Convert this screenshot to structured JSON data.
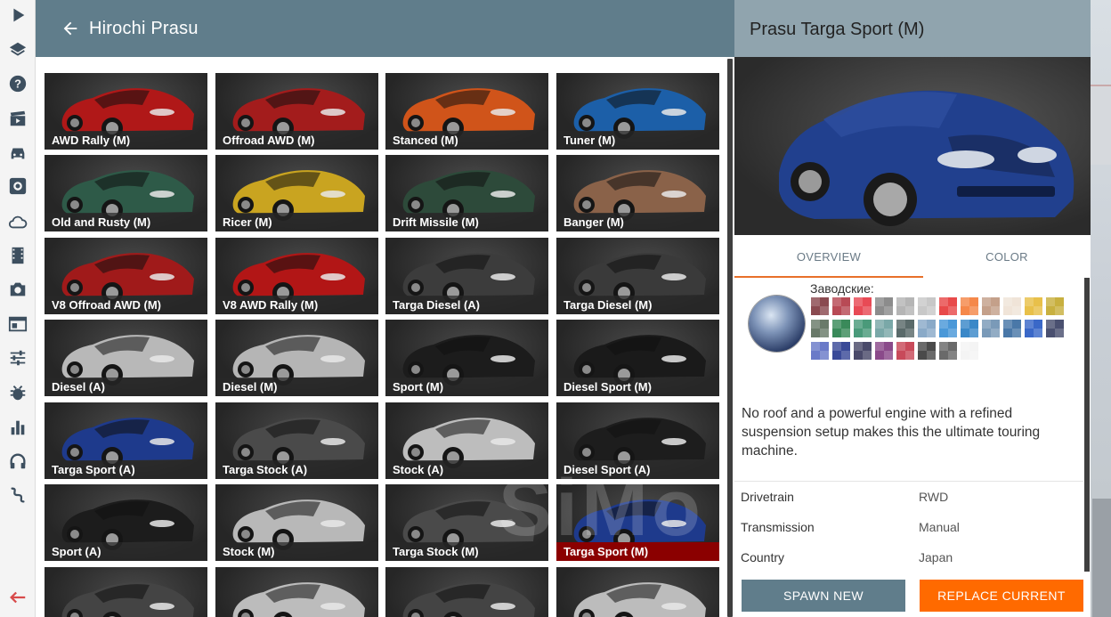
{
  "header": {
    "title": "Hirochi Prasu"
  },
  "sidebar_icons": [
    "play-icon",
    "layers-icon",
    "help-icon",
    "clapper-icon",
    "car-icon",
    "gear-box-icon",
    "cloud-icon",
    "film-icon",
    "camera-icon",
    "window-icon",
    "sliders-icon",
    "bug-icon",
    "chart-icon",
    "headphones-icon",
    "route-icon",
    "back-arrow-icon"
  ],
  "configs": [
    {
      "label": "AWD Rally (M)",
      "color": "#b01818"
    },
    {
      "label": "Offroad AWD (M)",
      "color": "#a31c1c"
    },
    {
      "label": "Stanced (M)",
      "color": "#d0541a"
    },
    {
      "label": "Tuner (M)",
      "color": "#1c5fa8"
    },
    {
      "label": "Old and Rusty (M)",
      "color": "#2e5a48"
    },
    {
      "label": "Ricer (M)",
      "color": "#c9a420"
    },
    {
      "label": "Drift Missile (M)",
      "color": "#2d4a3a"
    },
    {
      "label": "Banger (M)",
      "color": "#8a6249"
    },
    {
      "label": "V8 Offroad AWD (M)",
      "color": "#a01a1a"
    },
    {
      "label": "V8 AWD Rally (M)",
      "color": "#b21616"
    },
    {
      "label": "Targa Diesel (A)",
      "color": "#3c3c3c"
    },
    {
      "label": "Targa Diesel (M)",
      "color": "#3a3a3a"
    },
    {
      "label": "Diesel (A)",
      "color": "#b8b8b8"
    },
    {
      "label": "Diesel (M)",
      "color": "#b5b5b5"
    },
    {
      "label": "Sport (M)",
      "color": "#1c1c1c"
    },
    {
      "label": "Diesel Sport (M)",
      "color": "#1a1a1a"
    },
    {
      "label": "Targa Sport (A)",
      "color": "#1e3a8c"
    },
    {
      "label": "Targa Stock (A)",
      "color": "#4a4a4a"
    },
    {
      "label": "Stock (A)",
      "color": "#bdbdbd"
    },
    {
      "label": "Diesel Sport (A)",
      "color": "#1d1d1d"
    },
    {
      "label": "Sport (A)",
      "color": "#1c1c1c"
    },
    {
      "label": "Stock (M)",
      "color": "#b8b8b8"
    },
    {
      "label": "Targa Stock (M)",
      "color": "#4a4a4a"
    },
    {
      "label": "Targa Sport (M)",
      "color": "#1e3a8c",
      "selected": true
    },
    {
      "label": "",
      "color": "#444444"
    },
    {
      "label": "",
      "color": "#bcbcbc"
    },
    {
      "label": "",
      "color": "#444444"
    },
    {
      "label": "",
      "color": "#bcbcbc"
    }
  ],
  "details": {
    "title": "Prasu Targa Sport (M)",
    "tabs": [
      "OVERVIEW",
      "COLOR"
    ],
    "color_label": "Заводские:",
    "swatches": [
      "#8a4a50",
      "#b84a55",
      "#e84a55",
      "#8c8c8c",
      "#b5b5b5",
      "#c8c8c8",
      "#e84a4a",
      "#f5884a",
      "#c4a08a",
      "#f0e4d8",
      "#e8c04a",
      "#c8b040",
      "#6a7a6a",
      "#3a8a5a",
      "#4a9a7a",
      "#7aa8a8",
      "#5a6a6a",
      "#8aaac8",
      "#4a98d8",
      "#3a88c8",
      "#7a9ab8",
      "#4a78a8",
      "#3a68c8",
      "#4a5070",
      "#6a7ac8",
      "#3a4a98",
      "#4a4a6a",
      "#8a4a8a",
      "#c84a5a",
      "#4a4a4a",
      "#6a6a6a",
      "#f4f4f4"
    ],
    "description": "No roof and a powerful engine with a refined suspension setup makes this the ultimate touring machine.",
    "specs": [
      {
        "key": "Drivetrain",
        "value": "RWD"
      },
      {
        "key": "Transmission",
        "value": "Manual"
      },
      {
        "key": "Country",
        "value": "Japan"
      }
    ],
    "spawn_label": "SPAWN NEW",
    "replace_label": "REPLACE CURRENT"
  },
  "colors": {
    "header": "#607d8b",
    "detail_header": "#90a4ae",
    "accent": "#ff6a00",
    "selected": "#8b0000"
  }
}
